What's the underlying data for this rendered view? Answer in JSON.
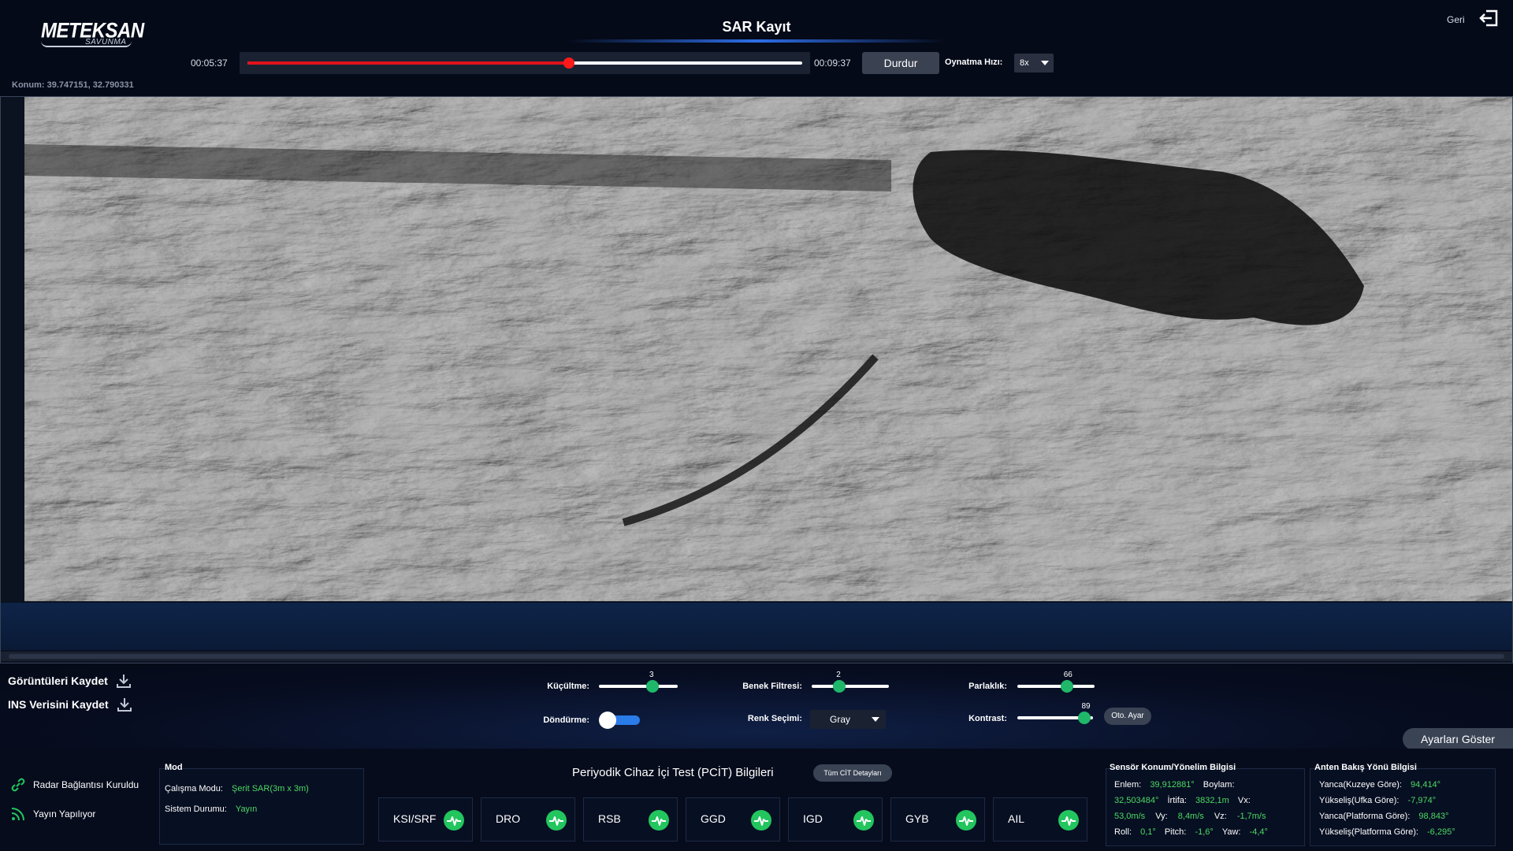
{
  "header": {
    "logo_main": "METEKSAN",
    "logo_sub": "SAVUNMA",
    "title": "SAR Kayıt",
    "back_label": "Geri",
    "time_start": "00:05:37",
    "time_end": "00:09:37",
    "progress_fraction": 0.58,
    "stop_label": "Durdur",
    "speed_label": "Oynatma Hızı:",
    "speed_value": "8x",
    "konum": "Konum: 39.747151, 32.790331"
  },
  "controls": {
    "save_images": "Görüntüleri Kaydet",
    "save_ins": "INS Verisini Kaydet",
    "kucultme_label": "Küçültme:",
    "kucultme_value": "3",
    "kucultme_fraction": 0.68,
    "dondurme_label": "Döndürme:",
    "benek_label": "Benek Filtresi:",
    "benek_value": "2",
    "benek_fraction": 0.36,
    "renk_label": "Renk Seçimi:",
    "renk_value": "Gray",
    "parlaklik_label": "Parlaklık:",
    "parlaklik_value": "66",
    "parlaklik_fraction": 0.64,
    "kontrast_label": "Kontrast:",
    "kontrast_value": "89",
    "kontrast_fraction": 0.89,
    "oto_label": "Oto. Ayar",
    "show_settings": "Ayarları Göster"
  },
  "status": {
    "radar": "Radar Bağlantısı Kuruldu",
    "broadcast": "Yayın Yapılıyor",
    "mod_title": "Mod",
    "calisma_label": "Çalışma Modu:",
    "calisma_value": "Şerit SAR(3m x 3m)",
    "sistem_label": "Sistem Durumu:",
    "sistem_value": "Yayın",
    "pcit_title": "Periyodik Cihaz İçi Test (PCİT) Bilgileri",
    "pcit_button": "Tüm CİT Detayları",
    "devices": [
      "KSI/SRF",
      "DRO",
      "RSB",
      "GGD",
      "IGD",
      "GYB",
      "AIL"
    ],
    "sensor_title": "Sensör Konum/Yönelim Bilgisi",
    "enlem_label": "Enlem:",
    "enlem_value": "39,912881°",
    "boylam_label": "Boylam:",
    "boylam_value": "32,503484°",
    "irtifa_label": "İrtifa:",
    "irtifa_value": "3832,1m",
    "vx_label": "Vx:",
    "vx_value": "53,0m/s",
    "vy_label": "Vy:",
    "vy_value": "8,4m/s",
    "vz_label": "Vz:",
    "vz_value": "-1,7m/s",
    "roll_label": "Roll:",
    "roll_value": "0,1°",
    "pitch_label": "Pitch:",
    "pitch_value": "-1,6°",
    "yaw_label": "Yaw:",
    "yaw_value": "-4,4°",
    "anten_title": "Anten Bakış Yönü Bilgisi",
    "yanca_kuzey_label": "Yanca(Kuzeye Göre):",
    "yanca_kuzey_value": "94,414°",
    "yukselis_ufka_label": "Yükseliş(Ufka Göre):",
    "yukselis_ufka_value": "-7,974°",
    "yanca_platform_label": "Yanca(Platforma Göre):",
    "yanca_platform_value": "98,843°",
    "yukselis_platform_label": "Yükseliş(Platforma Göre):",
    "yukselis_platform_value": "-6,295°"
  },
  "colors": {
    "accent_green": "#1fb86a",
    "progress_red": "#e0121b",
    "toggle_blue": "#2a7ce8",
    "status_green": "#4cd964"
  }
}
